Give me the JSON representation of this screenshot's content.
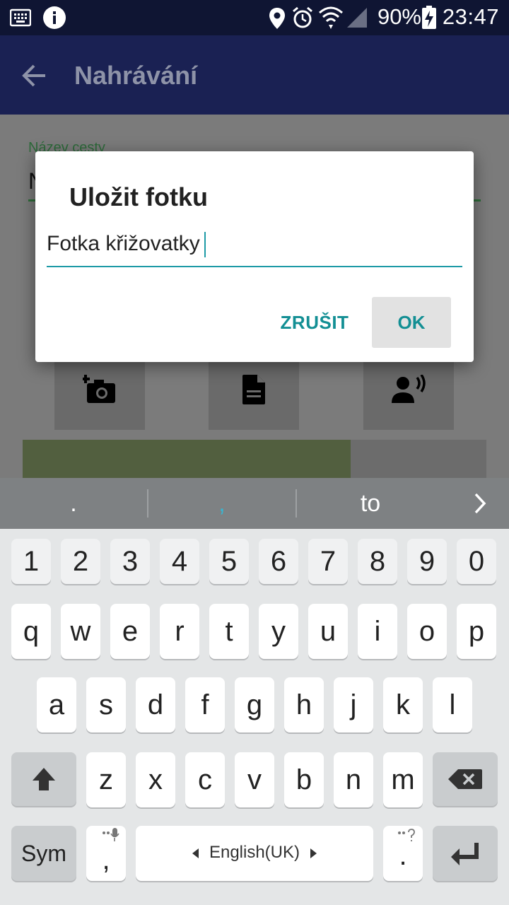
{
  "status_bar": {
    "battery": "90%",
    "time": "23:47",
    "icons": [
      "keyboard-icon",
      "info-icon",
      "location-icon",
      "alarm-icon",
      "wifi-icon",
      "signal-icon",
      "battery-charging-icon"
    ]
  },
  "app_bar": {
    "title": "Nahrávání",
    "back_icon": "arrow-back-icon"
  },
  "form": {
    "field_label": "Název cesty",
    "field_value_fragment": "N"
  },
  "action_tiles": [
    {
      "icon": "add-photo-icon"
    },
    {
      "icon": "document-icon"
    },
    {
      "icon": "record-voice-icon"
    }
  ],
  "dialog": {
    "title": "Uložit fotku",
    "input_value": "Fotka křižovatky",
    "cancel_label": "ZRUŠIT",
    "ok_label": "OK"
  },
  "suggestions": [
    ".",
    ",",
    "to"
  ],
  "keyboard": {
    "number_row": [
      "1",
      "2",
      "3",
      "4",
      "5",
      "6",
      "7",
      "8",
      "9",
      "0"
    ],
    "row1": [
      "q",
      "w",
      "e",
      "r",
      "t",
      "y",
      "u",
      "i",
      "o",
      "p"
    ],
    "row2": [
      "a",
      "s",
      "d",
      "f",
      "g",
      "h",
      "j",
      "k",
      "l"
    ],
    "row3": [
      "z",
      "x",
      "c",
      "v",
      "b",
      "n",
      "m"
    ],
    "sym_label": "Sym",
    "comma_label": ",",
    "space_label": "English(UK)",
    "period_label": ".",
    "colors": {
      "accent": "#138f94",
      "app_bar": "#1a2153",
      "status_bar": "#0f1533"
    }
  }
}
